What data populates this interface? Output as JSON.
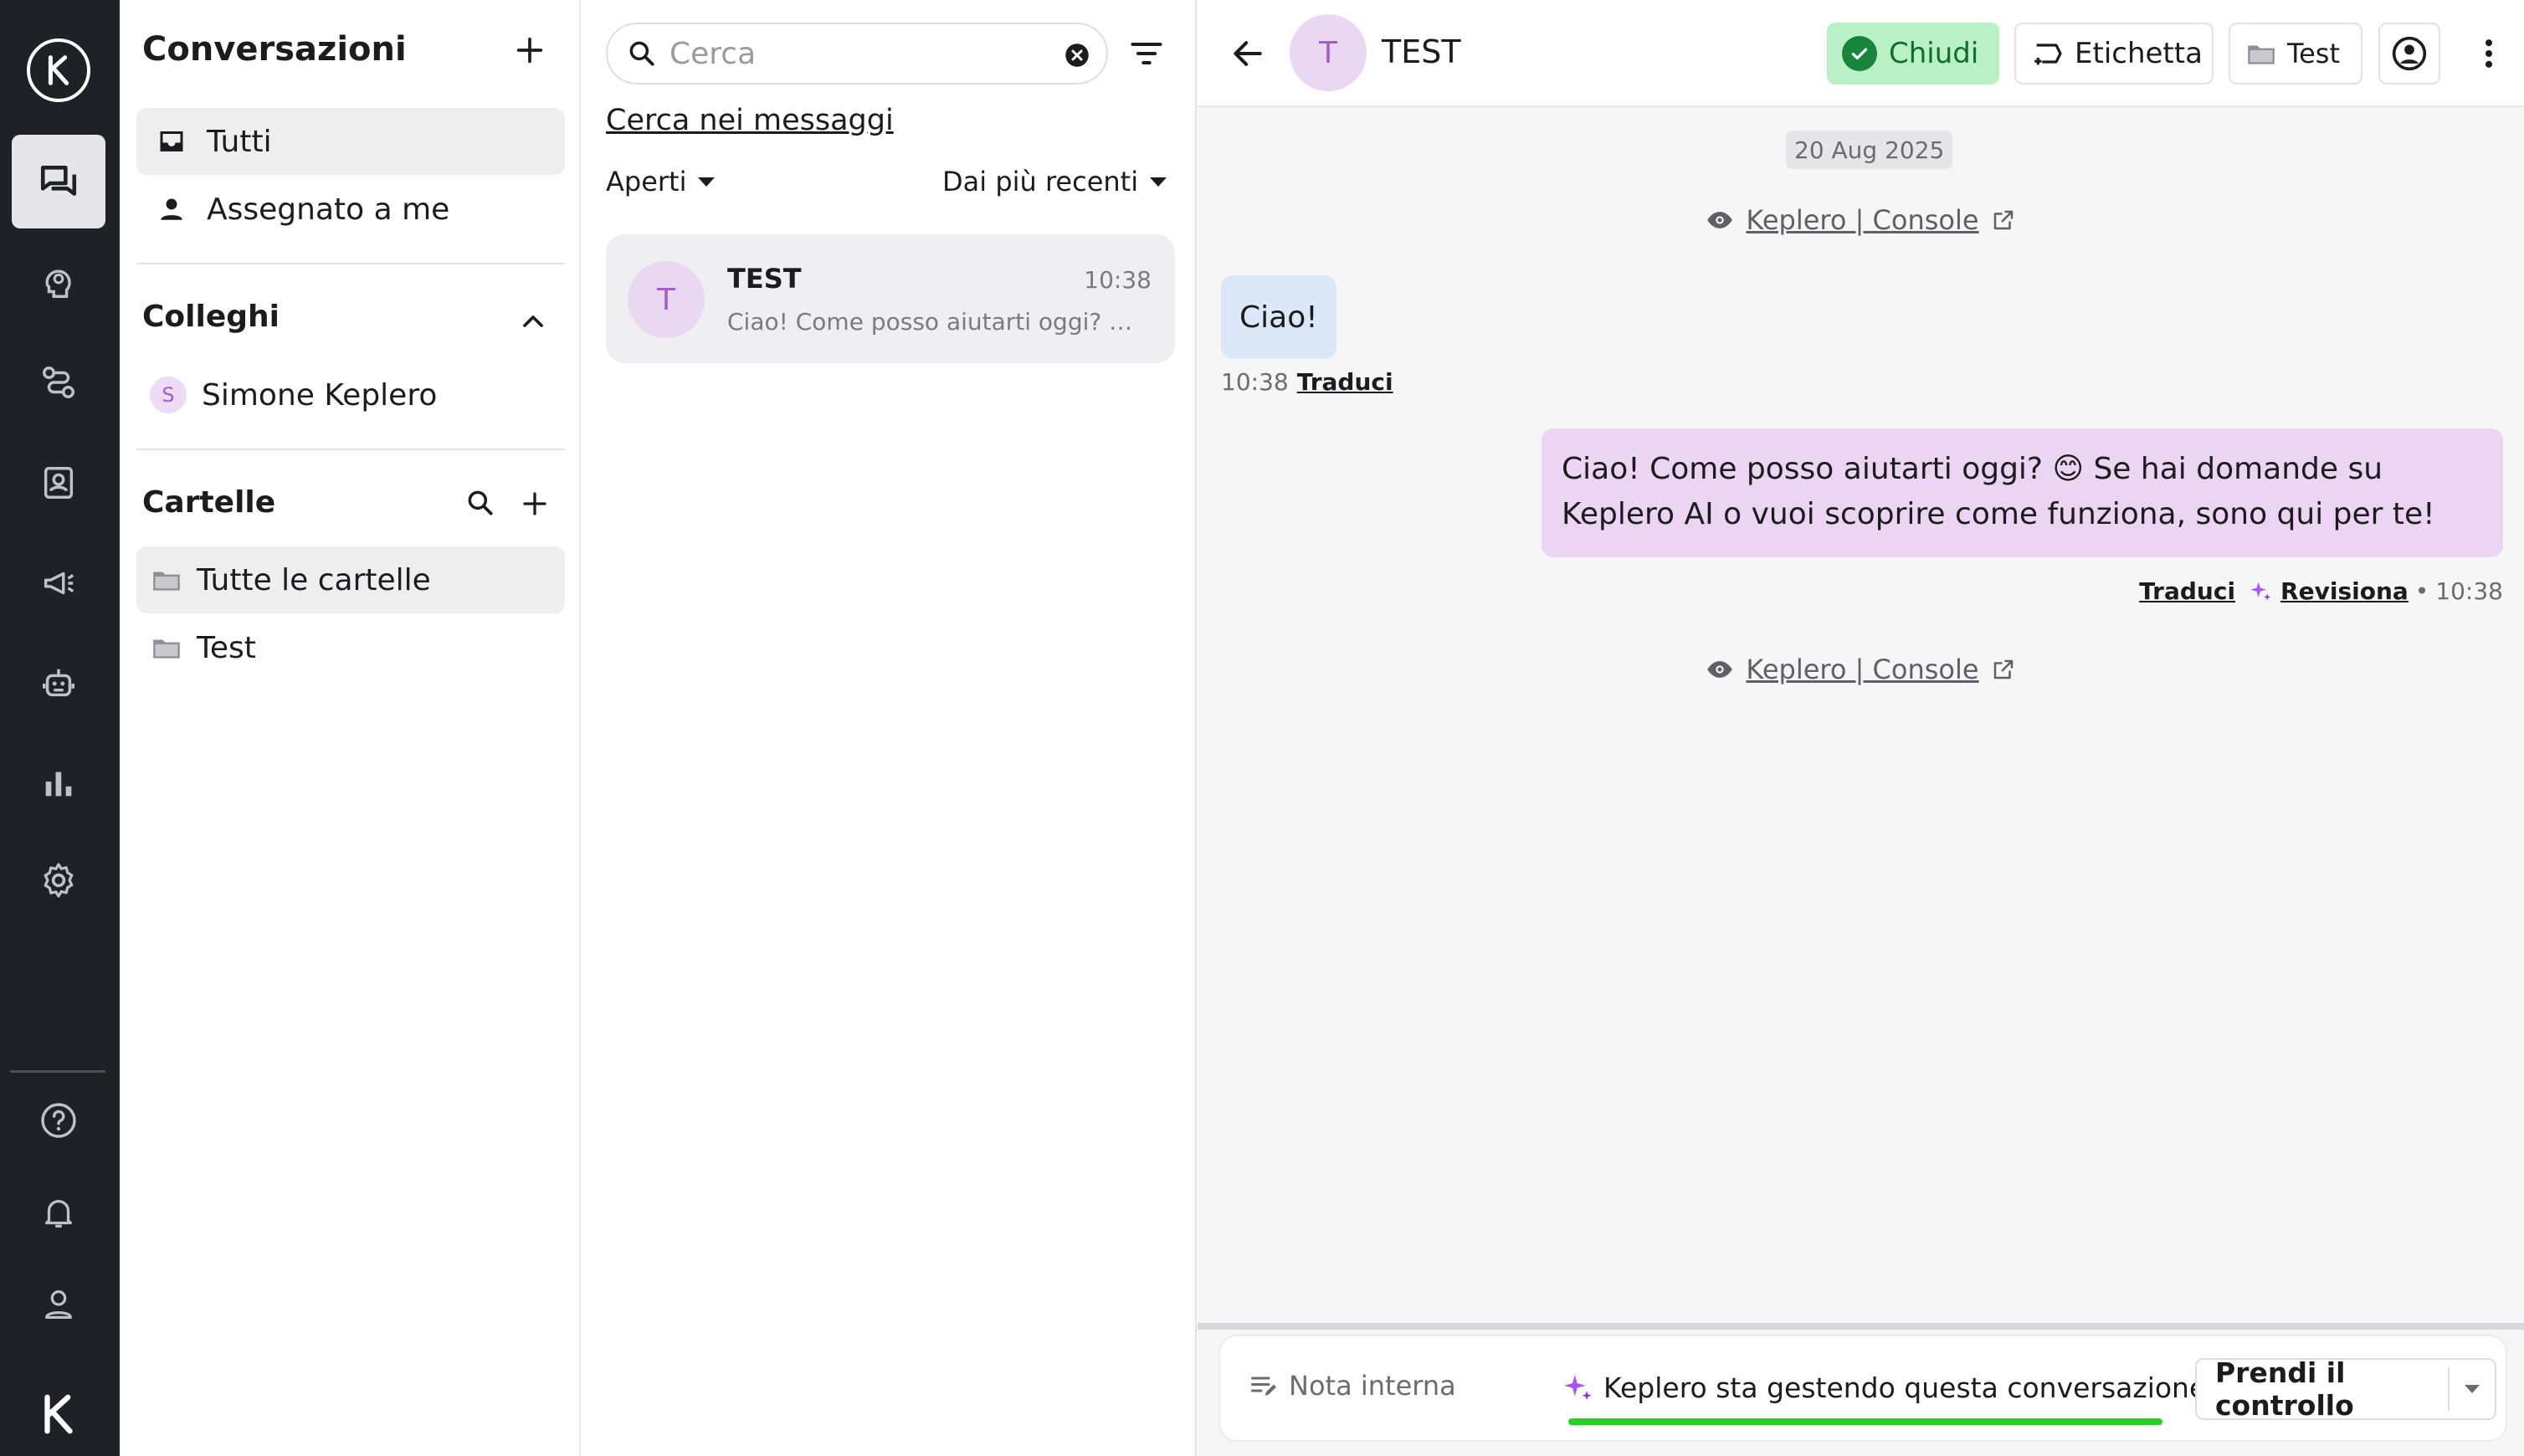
{
  "sidebar": {
    "title": "Conversazioni",
    "nav": [
      {
        "label": "Tutti",
        "icon": "inbox-icon",
        "active": true
      },
      {
        "label": "Assegnato a me",
        "icon": "person-icon",
        "active": false
      }
    ],
    "colleagues": {
      "title": "Colleghi",
      "items": [
        {
          "initial": "S",
          "label": "Simone Keplero"
        }
      ]
    },
    "folders": {
      "title": "Cartelle",
      "items": [
        {
          "label": "Tutte le cartelle",
          "active": true
        },
        {
          "label": "Test",
          "active": false
        }
      ]
    }
  },
  "list": {
    "search": {
      "placeholder": "Cerca",
      "value": ""
    },
    "search_messages": "Cerca nei messaggi",
    "status_filter": "Aperti",
    "sort": "Dai più recenti",
    "conversations": [
      {
        "initial": "T",
        "name": "TEST",
        "time": "10:38",
        "preview": "Ciao! Come posso aiutarti oggi? 😊 Se hai domande su Keplero AI o vuoi scoprire come funziona, sono qui per te!"
      }
    ]
  },
  "chat": {
    "contact": {
      "initial": "T",
      "name": "TEST"
    },
    "actions": {
      "close": "Chiudi",
      "label": "Etichetta",
      "folder": "Test"
    },
    "date": "20 Aug 2025",
    "event_link": "Keplero | Console",
    "incoming": {
      "text": "Ciao!",
      "time": "10:38",
      "translate": "Traduci"
    },
    "outgoing": {
      "text": "Ciao! Come posso aiutarti oggi? 😊 Se hai domande su Keplero AI o vuoi scoprire come funziona, sono qui per te!",
      "translate": "Traduci",
      "review": "Revisiona",
      "time": "10:38"
    },
    "composer": {
      "note": "Nota interna",
      "ai_status": "Keplero sta gestendo questa conversazione",
      "take_control": "Prendi il controllo"
    }
  },
  "colors": {
    "rail": "#1f2126",
    "accent_green": "#17863a",
    "avatar_purple": "#a55dce",
    "outgoing_bubble": "#ecd5f2",
    "incoming_bubble": "#dbe8f8",
    "highlight_underline": "#22d41e"
  }
}
